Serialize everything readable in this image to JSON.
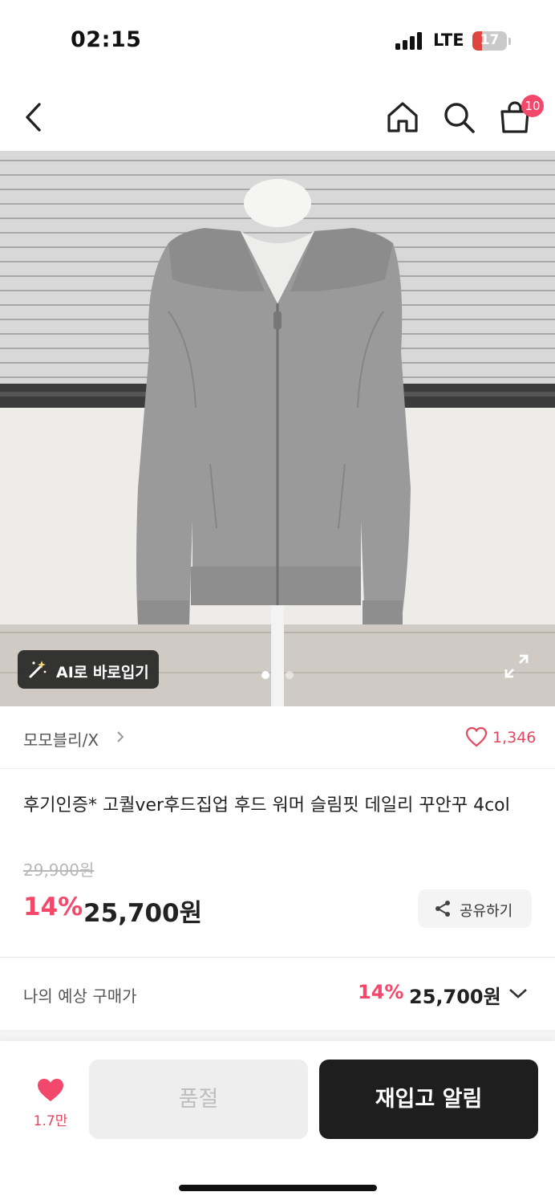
{
  "status_bar": {
    "time": "02:15",
    "network": "LTE",
    "battery_level": "17",
    "battery_color": "#e0443e"
  },
  "nav": {
    "back_icon": "chevron-left-icon",
    "home_icon": "home-icon",
    "search_icon": "search-icon",
    "cart_icon": "shopping-bag-icon",
    "cart_badge": "10",
    "badge_color": "#f2486b"
  },
  "gallery": {
    "image_description_icon": "product-photo",
    "ai_button_label": "AI로 바로입기",
    "ai_icon": "magic-wand-icon",
    "expand_icon": "fullscreen-icon",
    "page_count": 2,
    "current_page": 1
  },
  "store": {
    "name": "모모블리/X",
    "like_count": "1,346",
    "heart_icon": "heart-outline-icon"
  },
  "product": {
    "title": "후기인증* 고퀄ver후드집업 후드 워머 슬림핏 데일리 꾸안꾸 4col",
    "original_price": "29,900원",
    "discount_rate": "14%",
    "sale_price": "25,700원",
    "share_label": "공유하기",
    "share_icon": "share-icon"
  },
  "estimate": {
    "label": "나의 예상 구매가",
    "discount_rate": "14%",
    "price": "25,700원",
    "chevron_icon": "chevron-down-icon"
  },
  "bottom_bar": {
    "wish_count": "1.7만",
    "wish_icon": "heart-filled-icon",
    "soldout_label": "품절",
    "restock_label": "재입고 알림",
    "accent": "#f2486b"
  }
}
